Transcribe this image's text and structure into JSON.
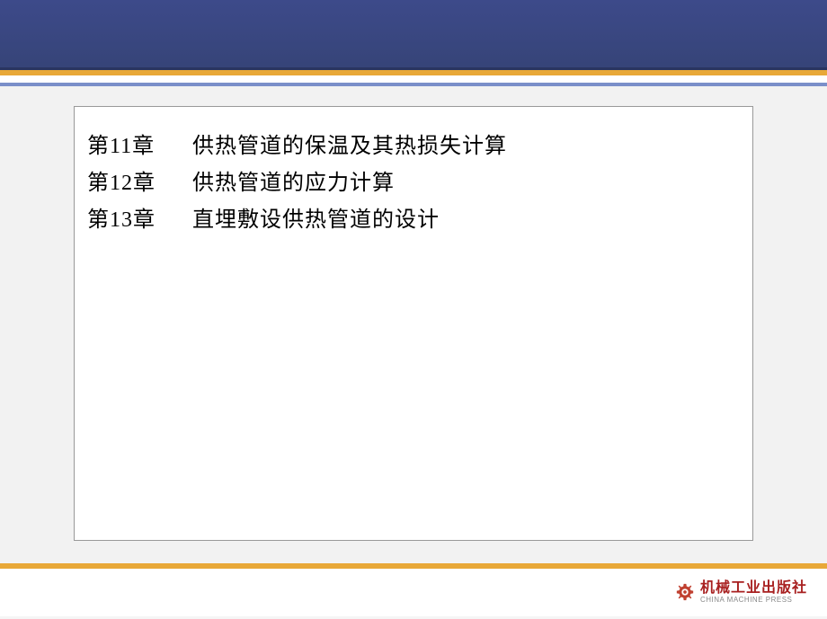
{
  "chapters": [
    {
      "label": "第11章",
      "title": "供热管道的保温及其热损失计算"
    },
    {
      "label": "第12章",
      "title": "供热管道的应力计算"
    },
    {
      "label": "第13章",
      "title": "直埋敷设供热管道的设计"
    }
  ],
  "publisher": {
    "cn": "机械工业出版社",
    "en": "CHINA MACHINE PRESS",
    "icon": "gear-icon"
  },
  "colors": {
    "header": "#364478",
    "accent": "#e8a838",
    "subaccent": "#7a8fc9",
    "brand": "#a82020"
  }
}
